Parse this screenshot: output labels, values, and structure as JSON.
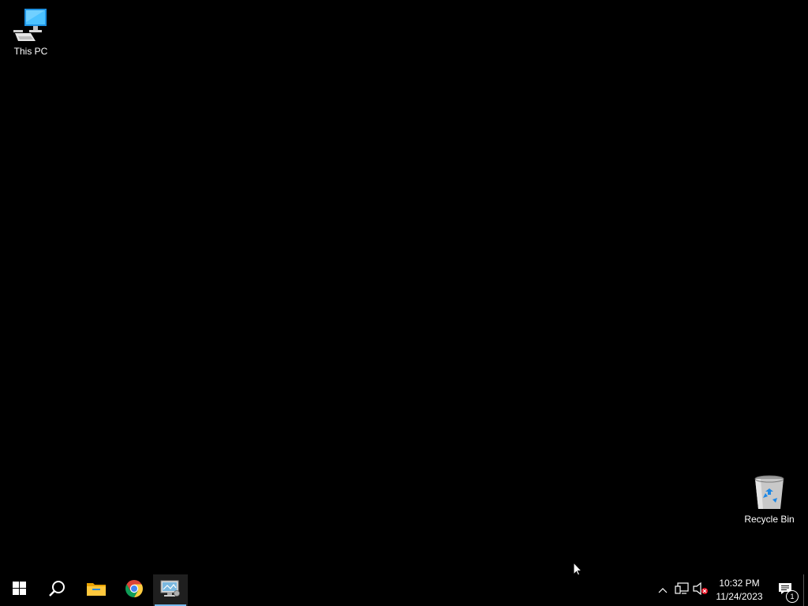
{
  "desktop": {
    "icons": [
      {
        "label": "This PC"
      },
      {
        "label": "Recycle Bin"
      }
    ]
  },
  "taskbar": {
    "start_icon": "windows-logo-icon",
    "search_icon": "search-icon",
    "pinned": [
      {
        "icon": "file-explorer-icon"
      },
      {
        "icon": "chrome-icon"
      },
      {
        "icon": "remote-desktop-icon",
        "running": true
      }
    ],
    "tray": {
      "overflow_icon": "chevron-up-icon",
      "network_icon": "network-icon",
      "volume_icon": "volume-muted-icon",
      "time": "10:32 PM",
      "date": "11/24/2023",
      "notification_count": "1"
    }
  },
  "colors": {
    "desktop_bg": "#000000",
    "taskbar_bg": "#000000",
    "accent": "#76b9ed"
  }
}
